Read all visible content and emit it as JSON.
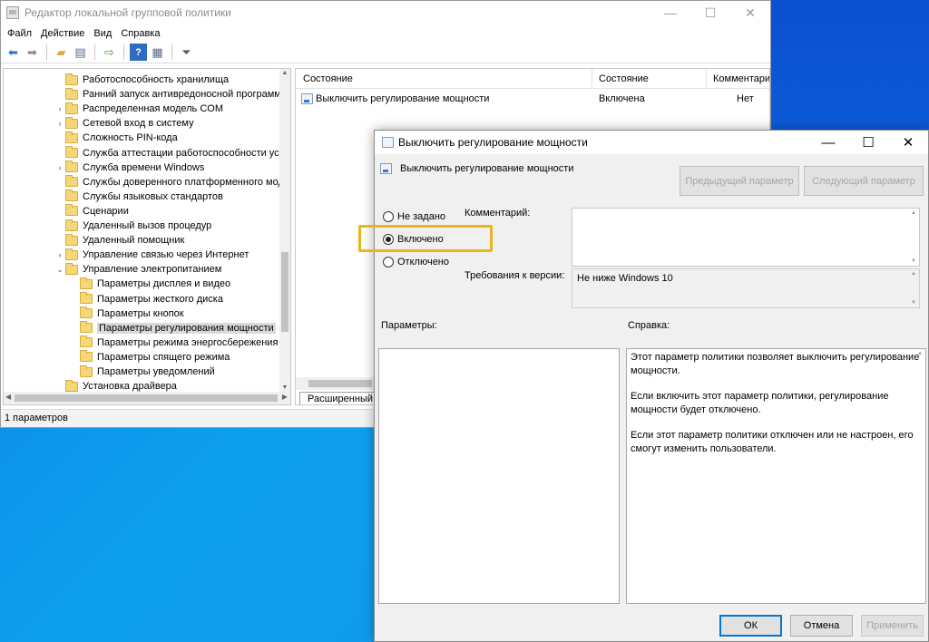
{
  "main_window": {
    "title": "Редактор локальной групповой политики",
    "menu": [
      "Файл",
      "Действие",
      "Вид",
      "Справка"
    ],
    "toolbar_icons": [
      "back-arrow-icon",
      "forward-arrow-icon",
      "folder-up-icon",
      "show-hide-tree-icon",
      "export-list-icon",
      "help-icon",
      "properties-icon",
      "filter-icon"
    ],
    "tree": [
      {
        "label": "Работоспособность хранилища",
        "indent": 0,
        "expander": ""
      },
      {
        "label": "Ранний запуск антивредоносной программы",
        "indent": 0,
        "expander": ""
      },
      {
        "label": "Распределенная модель COM",
        "indent": 0,
        "expander": "›"
      },
      {
        "label": "Сетевой вход в систему",
        "indent": 0,
        "expander": "›"
      },
      {
        "label": "Сложность PIN-кода",
        "indent": 0,
        "expander": ""
      },
      {
        "label": "Служба аттестации работоспособности устройств",
        "indent": 0,
        "expander": ""
      },
      {
        "label": "Служба времени Windows",
        "indent": 0,
        "expander": "›"
      },
      {
        "label": "Службы доверенного платформенного модуля",
        "indent": 0,
        "expander": ""
      },
      {
        "label": "Службы языковых стандартов",
        "indent": 0,
        "expander": ""
      },
      {
        "label": "Сценарии",
        "indent": 0,
        "expander": ""
      },
      {
        "label": "Удаленный вызов процедур",
        "indent": 0,
        "expander": ""
      },
      {
        "label": "Удаленный помощник",
        "indent": 0,
        "expander": ""
      },
      {
        "label": "Управление связью через Интернет",
        "indent": 0,
        "expander": "›"
      },
      {
        "label": "Управление электропитанием",
        "indent": 0,
        "expander": "⌄"
      },
      {
        "label": "Параметры дисплея и видео",
        "indent": 1,
        "expander": ""
      },
      {
        "label": "Параметры жесткого диска",
        "indent": 1,
        "expander": ""
      },
      {
        "label": "Параметры кнопок",
        "indent": 1,
        "expander": ""
      },
      {
        "label": "Параметры регулирования мощности",
        "indent": 1,
        "expander": "",
        "selected": true
      },
      {
        "label": "Параметры режима энергосбережения",
        "indent": 1,
        "expander": ""
      },
      {
        "label": "Параметры спящего режима",
        "indent": 1,
        "expander": ""
      },
      {
        "label": "Параметры уведомлений",
        "indent": 1,
        "expander": ""
      },
      {
        "label": "Установка драйвера",
        "indent": 0,
        "expander": ""
      }
    ],
    "list_columns": [
      "Состояние",
      "Состояние",
      "Комментари"
    ],
    "list_rows": [
      {
        "name": "Выключить регулирование мощности",
        "state": "Включена",
        "comment": "Нет"
      }
    ],
    "tab_extended": "Расширенный",
    "status": "1 параметров"
  },
  "dialog": {
    "title": "Выключить регулирование мощности",
    "policy_name": "Выключить регулирование мощности",
    "prev_button": "Предыдущий параметр",
    "next_button": "Следующий параметр",
    "radio_not_configured": "Не задано",
    "radio_enabled": "Включено",
    "radio_disabled": "Отключено",
    "selected_option": "enabled",
    "comment_label": "Комментарий:",
    "comment_value": "",
    "version_label": "Требования к версии:",
    "version_value": "Не ниже Windows 10",
    "options_label": "Параметры:",
    "help_label": "Справка:",
    "help_paragraphs": [
      "Этот параметр политики позволяет выключить регулирование мощности.",
      "Если включить этот параметр политики, регулирование мощности будет отключено.",
      "Если этот параметр политики отключен или не настроен, его смогут изменить пользователи."
    ],
    "ok_button": "ОК",
    "cancel_button": "Отмена",
    "apply_button": "Применить",
    "highlight_color": "#e8b51c"
  }
}
